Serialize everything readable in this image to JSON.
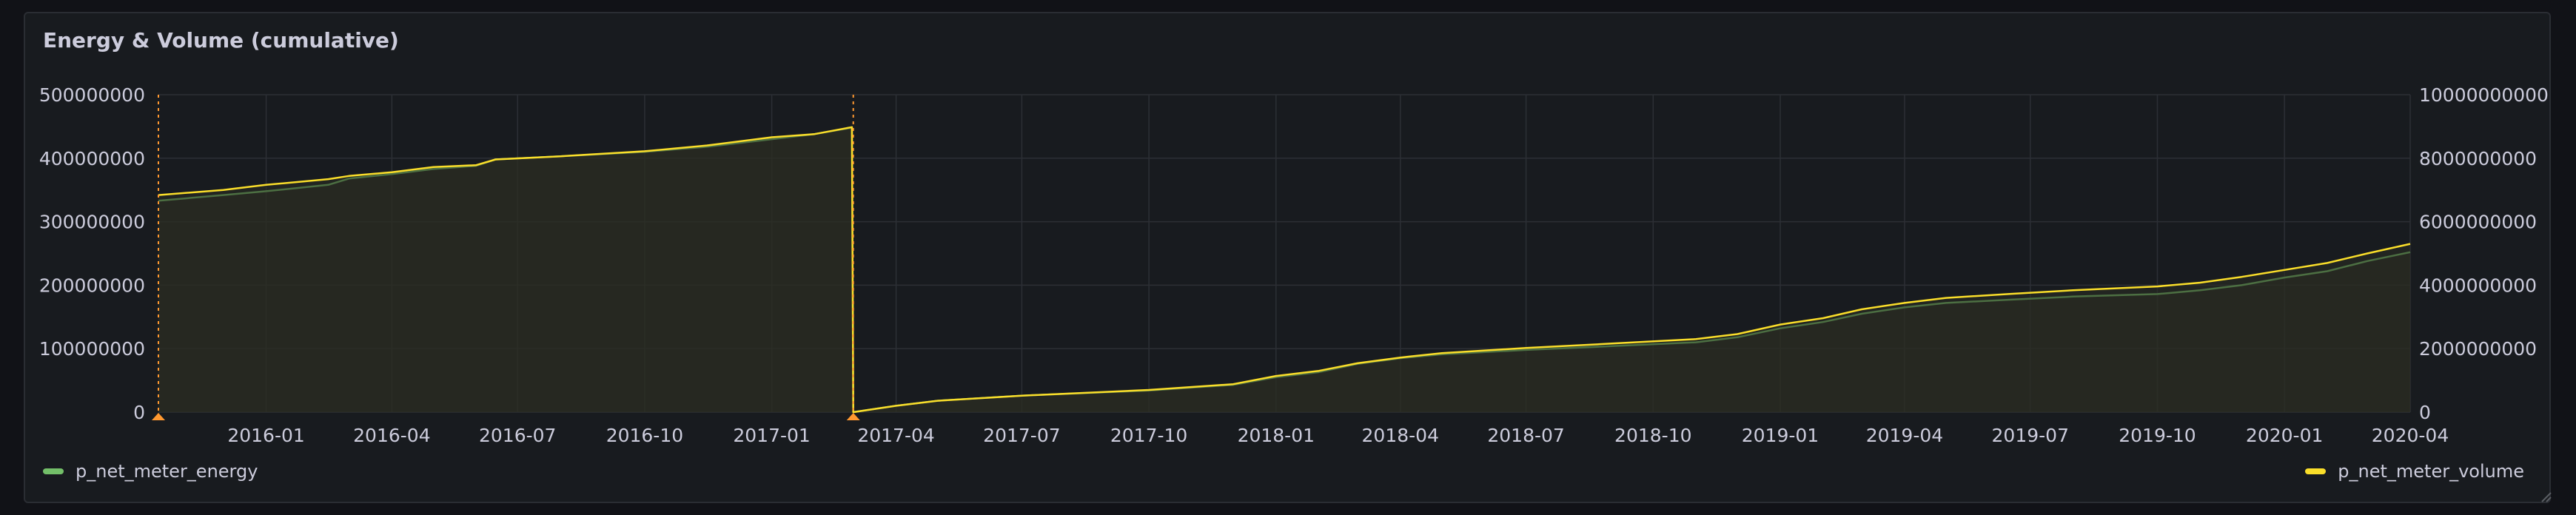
{
  "panel": {
    "title": "Energy & Volume (cumulative)"
  },
  "colors": {
    "energy": "#73bf69",
    "volume": "#fade2a",
    "annotation": "#ff9830",
    "grid": "#2c2f35",
    "fill": "#2b2e22"
  },
  "legend": {
    "left": "p_net_meter_energy",
    "right": "p_net_meter_volume"
  },
  "chart_data": {
    "type": "line",
    "title": "Energy & Volume (cumulative)",
    "xlabel": "",
    "ylabel": "",
    "x_range": [
      "2015-10-15",
      "2020-04-01"
    ],
    "y_left": {
      "range": [
        0,
        500000000
      ],
      "ticks": [
        "500000000",
        "400000000",
        "300000000",
        "200000000",
        "100000000",
        "0"
      ]
    },
    "y_right": {
      "range": [
        0,
        10000000000
      ],
      "ticks": [
        "10000000000",
        "8000000000",
        "6000000000",
        "4000000000",
        "2000000000",
        "0"
      ]
    },
    "x_ticks": [
      "2016-01",
      "2016-04",
      "2016-07",
      "2016-10",
      "2017-01",
      "2017-04",
      "2017-07",
      "2017-10",
      "2018-01",
      "2018-04",
      "2018-07",
      "2018-10",
      "2019-01",
      "2019-04",
      "2019-07",
      "2019-10",
      "2020-01",
      "2020-04"
    ],
    "annotations": [
      "2015-10-15",
      "2017-03-01"
    ],
    "grid": true,
    "legend_position": "bottom",
    "series": [
      {
        "name": "p_net_meter_energy",
        "axis": "left",
        "points": [
          [
            "2015-10-15",
            333000000
          ],
          [
            "2015-12-01",
            342000000
          ],
          [
            "2016-01-01",
            348000000
          ],
          [
            "2016-02-15",
            358000000
          ],
          [
            "2016-03-01",
            368000000
          ],
          [
            "2016-04-01",
            375000000
          ],
          [
            "2016-05-01",
            383000000
          ],
          [
            "2016-06-01",
            388000000
          ],
          [
            "2016-06-15",
            398000000
          ],
          [
            "2016-08-01",
            403000000
          ],
          [
            "2016-10-01",
            410000000
          ],
          [
            "2016-11-15",
            418000000
          ],
          [
            "2017-01-01",
            430000000
          ],
          [
            "2017-02-01",
            438000000
          ],
          [
            "2017-02-28",
            448000000
          ],
          [
            "2017-03-01",
            0
          ],
          [
            "2017-04-01",
            10000000
          ],
          [
            "2017-05-01",
            18000000
          ],
          [
            "2017-07-01",
            26000000
          ],
          [
            "2017-10-01",
            34000000
          ],
          [
            "2017-12-01",
            43000000
          ],
          [
            "2018-01-01",
            55000000
          ],
          [
            "2018-02-01",
            63000000
          ],
          [
            "2018-03-01",
            76000000
          ],
          [
            "2018-04-01",
            85000000
          ],
          [
            "2018-05-01",
            91000000
          ],
          [
            "2018-07-01",
            98000000
          ],
          [
            "2018-09-01",
            104000000
          ],
          [
            "2018-11-01",
            110000000
          ],
          [
            "2018-12-01",
            118000000
          ],
          [
            "2019-01-01",
            132000000
          ],
          [
            "2019-02-01",
            142000000
          ],
          [
            "2019-03-01",
            155000000
          ],
          [
            "2019-04-01",
            165000000
          ],
          [
            "2019-05-01",
            172000000
          ],
          [
            "2019-06-15",
            177000000
          ],
          [
            "2019-08-01",
            182000000
          ],
          [
            "2019-10-01",
            186000000
          ],
          [
            "2019-11-01",
            192000000
          ],
          [
            "2019-12-01",
            200000000
          ],
          [
            "2020-01-01",
            212000000
          ],
          [
            "2020-02-01",
            222000000
          ],
          [
            "2020-03-01",
            238000000
          ],
          [
            "2020-04-01",
            252000000
          ]
        ]
      },
      {
        "name": "p_net_meter_volume",
        "axis": "right",
        "points": [
          [
            "2015-10-15",
            6840000000
          ],
          [
            "2015-12-01",
            7000000000
          ],
          [
            "2016-01-01",
            7160000000
          ],
          [
            "2016-02-15",
            7340000000
          ],
          [
            "2016-03-01",
            7440000000
          ],
          [
            "2016-04-01",
            7560000000
          ],
          [
            "2016-05-01",
            7720000000
          ],
          [
            "2016-06-01",
            7780000000
          ],
          [
            "2016-06-15",
            7960000000
          ],
          [
            "2016-08-01",
            8060000000
          ],
          [
            "2016-10-01",
            8220000000
          ],
          [
            "2016-11-15",
            8400000000
          ],
          [
            "2017-01-01",
            8660000000
          ],
          [
            "2017-02-01",
            8760000000
          ],
          [
            "2017-02-28",
            8980000000
          ],
          [
            "2017-03-01",
            0
          ],
          [
            "2017-04-01",
            200000000
          ],
          [
            "2017-05-01",
            360000000
          ],
          [
            "2017-07-01",
            520000000
          ],
          [
            "2017-10-01",
            700000000
          ],
          [
            "2017-12-01",
            880000000
          ],
          [
            "2018-01-01",
            1140000000
          ],
          [
            "2018-02-01",
            1300000000
          ],
          [
            "2018-03-01",
            1540000000
          ],
          [
            "2018-04-01",
            1720000000
          ],
          [
            "2018-05-01",
            1860000000
          ],
          [
            "2018-07-01",
            2020000000
          ],
          [
            "2018-09-01",
            2160000000
          ],
          [
            "2018-11-01",
            2300000000
          ],
          [
            "2018-12-01",
            2460000000
          ],
          [
            "2019-01-01",
            2760000000
          ],
          [
            "2019-02-01",
            2960000000
          ],
          [
            "2019-03-01",
            3240000000
          ],
          [
            "2019-04-01",
            3440000000
          ],
          [
            "2019-05-01",
            3600000000
          ],
          [
            "2019-06-15",
            3720000000
          ],
          [
            "2019-08-01",
            3840000000
          ],
          [
            "2019-10-01",
            3960000000
          ],
          [
            "2019-11-01",
            4080000000
          ],
          [
            "2019-12-01",
            4260000000
          ],
          [
            "2020-01-01",
            4480000000
          ],
          [
            "2020-02-01",
            4700000000
          ],
          [
            "2020-03-01",
            5000000000
          ],
          [
            "2020-04-01",
            5300000000
          ]
        ]
      }
    ]
  }
}
